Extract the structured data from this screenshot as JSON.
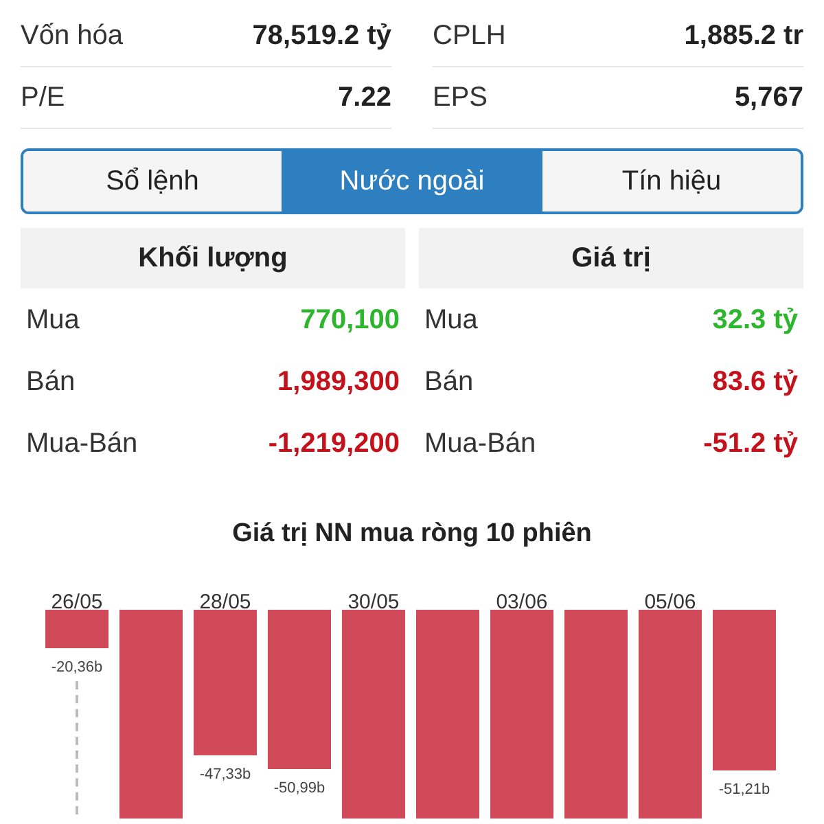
{
  "stats": [
    {
      "label": "Vốn hóa",
      "value": "78,519.2 tỷ"
    },
    {
      "label": "CPLH",
      "value": "1,885.2 tr"
    },
    {
      "label": "P/E",
      "value": "7.22"
    },
    {
      "label": "EPS",
      "value": "5,767"
    }
  ],
  "tabs": [
    {
      "label": "Sổ lệnh",
      "selected": false
    },
    {
      "label": "Nước ngoài",
      "selected": true
    },
    {
      "label": "Tín hiệu",
      "selected": false
    }
  ],
  "tables": [
    {
      "title": "Khối lượng",
      "rows": [
        {
          "label": "Mua",
          "value": "770,100",
          "kind": "buy"
        },
        {
          "label": "Bán",
          "value": "1,989,300",
          "kind": "sell"
        },
        {
          "label": "Mua-Bán",
          "value": "-1,219,200",
          "kind": "sell"
        }
      ]
    },
    {
      "title": "Giá trị",
      "rows": [
        {
          "label": "Mua",
          "value": "32.3 tỷ",
          "kind": "buy"
        },
        {
          "label": "Bán",
          "value": "83.6 tỷ",
          "kind": "sell"
        },
        {
          "label": "Mua-Bán",
          "value": "-51.2 tỷ",
          "kind": "sell"
        }
      ]
    }
  ],
  "chart": {
    "title": "Giá trị NN mua ròng 10 phiên",
    "bars": [
      {
        "date": "26/05",
        "value_label": "-20,36b",
        "clipped": false
      },
      {
        "clipped": true
      },
      {
        "date": "28/05",
        "value_label": "-47,33b",
        "clipped": false
      },
      {
        "value_label": "-50,99b",
        "clipped": false
      },
      {
        "date": "30/05",
        "clipped": true
      },
      {
        "clipped": true
      },
      {
        "date": "03/06",
        "clipped": true
      },
      {
        "clipped": true
      },
      {
        "date": "05/06",
        "clipped": true
      },
      {
        "value_label": "-51,21b",
        "clipped": false
      }
    ]
  }
}
